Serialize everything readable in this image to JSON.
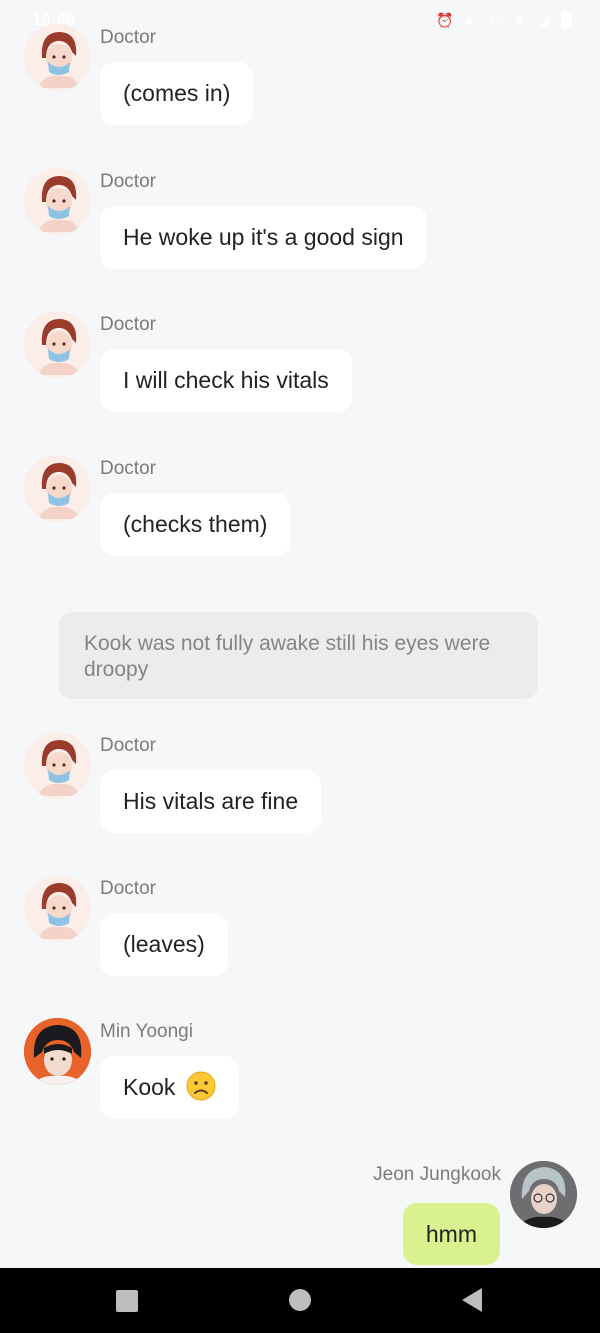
{
  "status_bar": {
    "time": "10:40",
    "icons": [
      "alarm-icon",
      "vibrate-icon",
      "call-icon",
      "wifi-icon",
      "signal-icon",
      "battery-icon"
    ]
  },
  "messages": [
    {
      "sender": "Doctor",
      "text": "(comes in)"
    },
    {
      "sender": "Doctor",
      "text": "He woke up it's a good sign"
    },
    {
      "sender": "Doctor",
      "text": "I will check his vitals"
    },
    {
      "sender": "Doctor",
      "text": "(checks them)"
    },
    {
      "narration": "Kook was not fully awake still his eyes were droopy"
    },
    {
      "sender": "Doctor",
      "text": "His vitals are fine"
    },
    {
      "sender": "Doctor",
      "text": "(leaves)"
    },
    {
      "sender": "Min Yoongi",
      "text": "Kook",
      "emoji": "worried-face"
    },
    {
      "sender": "Jeon Jungkook",
      "text": "hmm"
    }
  ],
  "colors": {
    "background": "#f6f7f9",
    "bubble": "#ffffff",
    "self_bubble": "#d9f18f",
    "narration": "#ececee",
    "nav_bar": "#000000"
  },
  "nav_bar": {
    "buttons": [
      "recents-button",
      "home-button",
      "back-button"
    ]
  }
}
